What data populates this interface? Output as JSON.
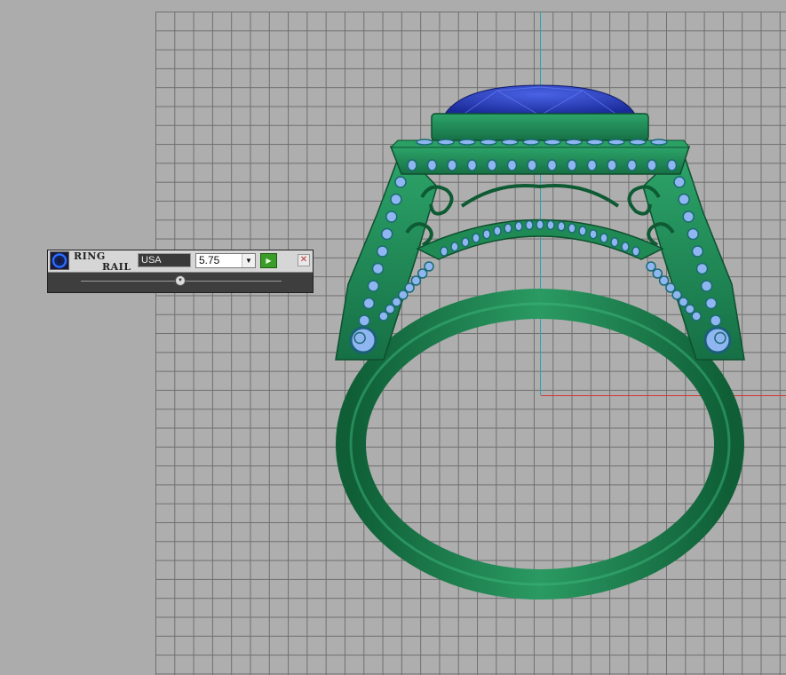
{
  "panel": {
    "title_line1": "RING",
    "title_line2": "RAIL",
    "region_value": "USA",
    "size_value": "5.75",
    "slider_value_fraction": 0.5
  },
  "icons": {
    "app_icon": "ring-rail-icon",
    "dropdown": "chevron-down-icon",
    "apply": "play-icon",
    "close": "close-icon",
    "slider_thumb": "slider-handle-icon"
  },
  "colors": {
    "background": "#acacac",
    "grid_line": "#6f6f6f",
    "ring_metal": "#1f8a53",
    "gem_center": "#2b3fb8",
    "side_stones": "#8fb6f0",
    "axis_vertical": "#2aa3b3",
    "axis_horizontal": "#d43434"
  }
}
